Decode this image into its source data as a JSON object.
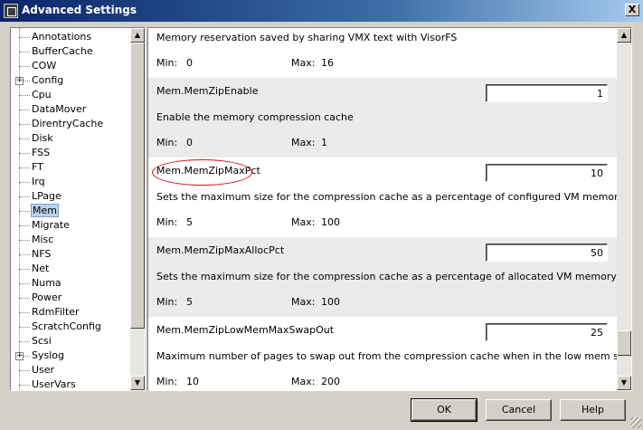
{
  "window": {
    "title": "Advanced Settings",
    "close_label": "X"
  },
  "tree": {
    "items": [
      {
        "label": "Annotations",
        "expandable": false
      },
      {
        "label": "BufferCache",
        "expandable": false
      },
      {
        "label": "COW",
        "expandable": false
      },
      {
        "label": "Config",
        "expandable": true
      },
      {
        "label": "Cpu",
        "expandable": false
      },
      {
        "label": "DataMover",
        "expandable": false
      },
      {
        "label": "DirentryCache",
        "expandable": false
      },
      {
        "label": "Disk",
        "expandable": false
      },
      {
        "label": "FSS",
        "expandable": false
      },
      {
        "label": "FT",
        "expandable": false
      },
      {
        "label": "Irq",
        "expandable": false
      },
      {
        "label": "LPage",
        "expandable": false
      },
      {
        "label": "Mem",
        "expandable": false,
        "selected": true
      },
      {
        "label": "Migrate",
        "expandable": false
      },
      {
        "label": "Misc",
        "expandable": false
      },
      {
        "label": "NFS",
        "expandable": false
      },
      {
        "label": "Net",
        "expandable": false
      },
      {
        "label": "Numa",
        "expandable": false
      },
      {
        "label": "Power",
        "expandable": false
      },
      {
        "label": "RdmFilter",
        "expandable": false
      },
      {
        "label": "ScratchConfig",
        "expandable": false
      },
      {
        "label": "Scsi",
        "expandable": false
      },
      {
        "label": "Syslog",
        "expandable": true
      },
      {
        "label": "User",
        "expandable": false
      },
      {
        "label": "UserVars",
        "expandable": false
      }
    ],
    "expander_symbol": "+"
  },
  "labels": {
    "min": "Min:",
    "max": "Max:"
  },
  "settings": [
    {
      "name": "",
      "value": "",
      "desc": "Memory reservation saved by sharing VMX text with VisorFS",
      "min": "0",
      "max": "16",
      "partial": true
    },
    {
      "name": "Mem.MemZipEnable",
      "value": "1",
      "desc": "Enable the memory compression cache",
      "min": "0",
      "max": "1"
    },
    {
      "name": "Mem.MemZipMaxPct",
      "value": "10",
      "desc": "Sets the maximum size for the compression cache as a percentage of configured VM memory size",
      "min": "5",
      "max": "100",
      "highlighted": true
    },
    {
      "name": "Mem.MemZipMaxAllocPct",
      "value": "50",
      "desc": "Sets the maximum size for the compression cache as a percentage of allocated VM memory size",
      "min": "5",
      "max": "100"
    },
    {
      "name": "Mem.MemZipLowMemMaxSwapOut",
      "value": "25",
      "desc": "Maximum number of pages to swap out from the compression cache when in the low mem state",
      "min": "10",
      "max": "200"
    }
  ],
  "buttons": {
    "ok": "OK",
    "cancel": "Cancel",
    "help": "Help"
  }
}
